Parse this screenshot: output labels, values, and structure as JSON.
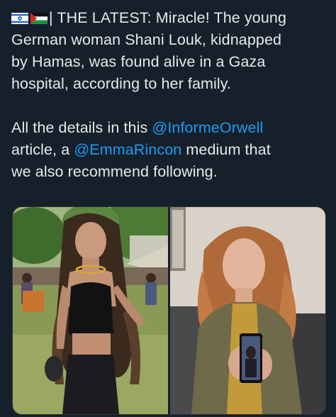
{
  "tweet": {
    "flags": [
      "israel-flag-icon",
      "palestine-flag-icon"
    ],
    "line1": "| THE LATEST: Miracle! The young",
    "line2": "German woman Shani Louk, kidnapped",
    "line3": "by Hamas, was found alive in a Gaza",
    "line4": "hospital, according to her family.",
    "line5_pre": "All the details in this ",
    "mention1": "@InformeOrwell",
    "line6_pre": "article, a ",
    "mention2": "@EmmaRincon",
    "line6_post": " medium that",
    "line7": "we also recommend following."
  },
  "media": {
    "images": [
      "woman-with-dreadlocks-photo",
      "mother-holding-phone-photo"
    ]
  },
  "colors": {
    "background": "#15202b",
    "text": "#e7e9ea",
    "mention": "#1d9bf0"
  }
}
